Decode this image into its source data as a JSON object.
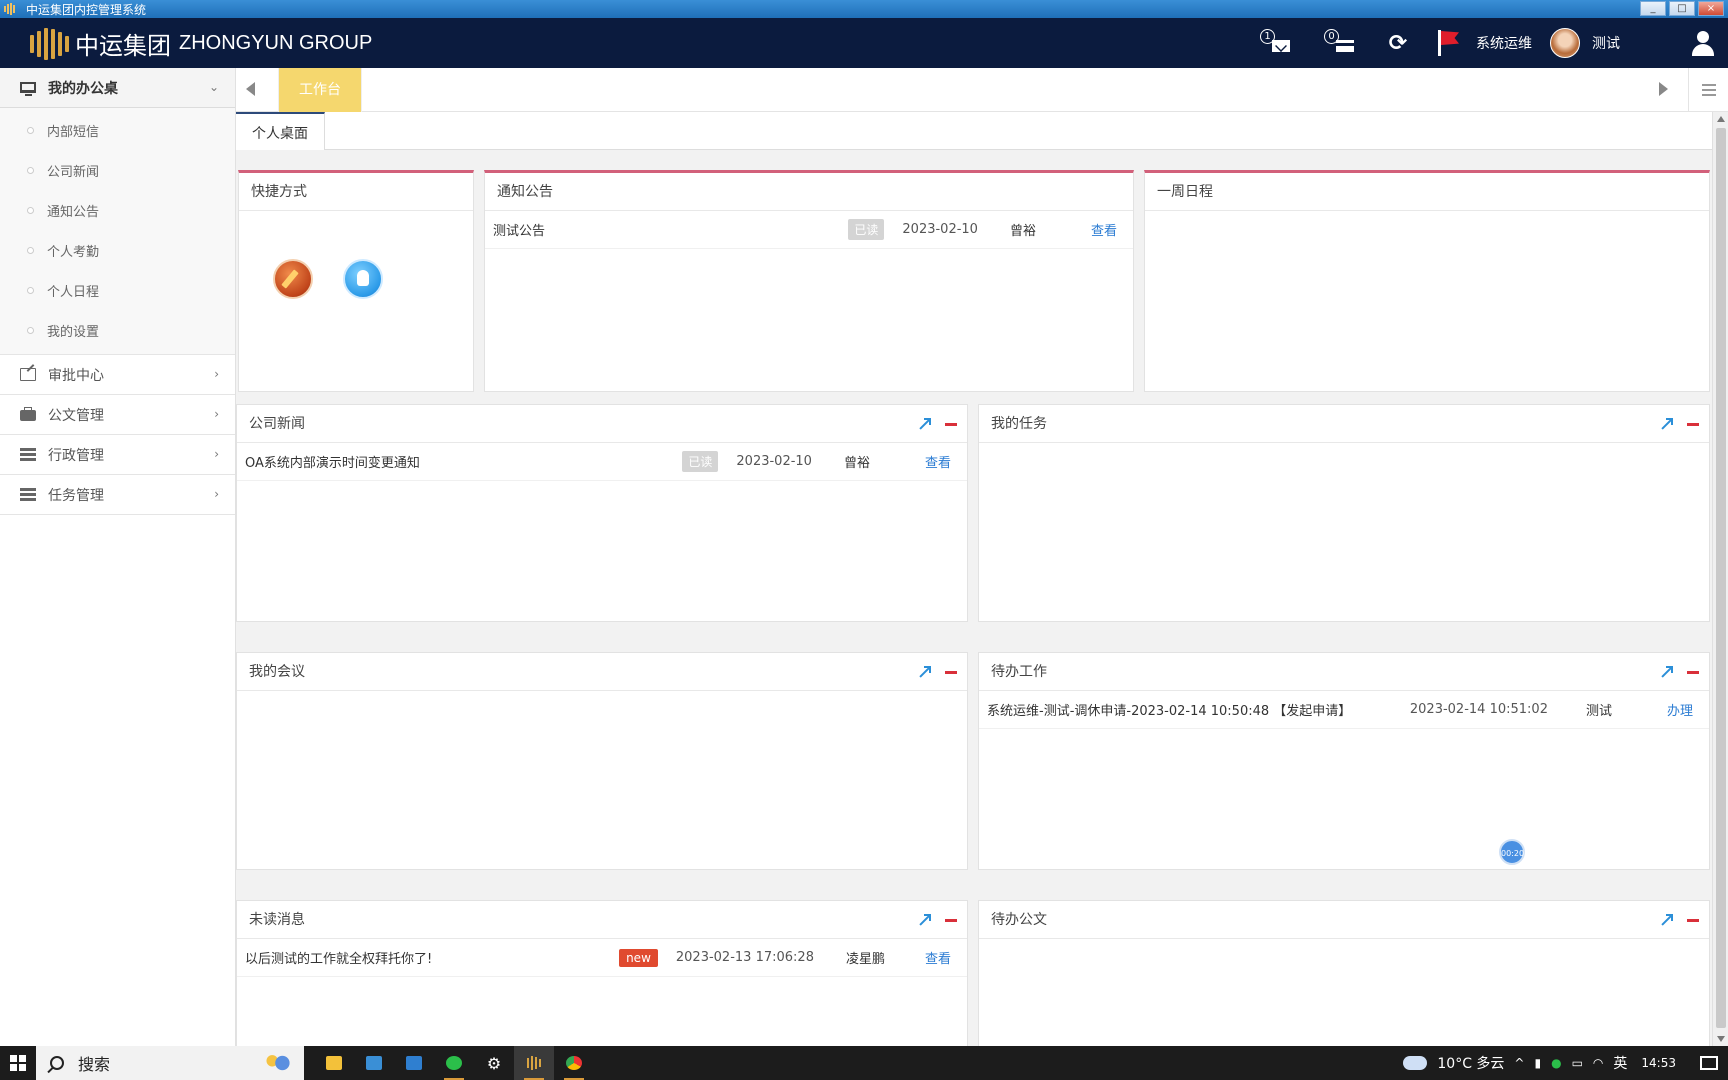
{
  "window": {
    "title": "中运集团内控管理系统",
    "buttons": [
      "_",
      "□",
      "×"
    ]
  },
  "header": {
    "brand_cn": "中运集团",
    "brand_en": "ZHONGYUN GROUP",
    "mail_count": "1",
    "notice_count": "0",
    "role_label": "系统运维",
    "user_name": "测试"
  },
  "sidebar": {
    "groups": [
      {
        "label": "我的办公桌",
        "icon": "monitor-icon",
        "expanded": true,
        "items": [
          "内部短信",
          "公司新闻",
          "通知公告",
          "个人考勤",
          "个人日程",
          "我的设置"
        ]
      },
      {
        "label": "审批中心",
        "icon": "edit-icon",
        "expanded": false
      },
      {
        "label": "公文管理",
        "icon": "briefcase-icon",
        "expanded": false
      },
      {
        "label": "行政管理",
        "icon": "server-icon",
        "expanded": false
      },
      {
        "label": "任务管理",
        "icon": "server-icon",
        "expanded": false
      }
    ]
  },
  "tabs": {
    "active": "工作台",
    "active_color": "#f5d76e"
  },
  "subtabs": {
    "active": "个人桌面"
  },
  "panels": {
    "shortcuts": {
      "title": "快捷方式"
    },
    "notices": {
      "title": "通知公告",
      "rows": [
        {
          "title": "测试公告",
          "status": "已读",
          "date": "2023-02-10",
          "user": "曾裕",
          "action": "查看"
        }
      ]
    },
    "week_schedule": {
      "title": "一周日程"
    },
    "company_news": {
      "title": "公司新闻",
      "rows": [
        {
          "title": "OA系统内部演示时间变更通知",
          "status": "已读",
          "date": "2023-02-10",
          "user": "曾裕",
          "action": "查看"
        }
      ]
    },
    "my_tasks": {
      "title": "我的任务"
    },
    "my_meetings": {
      "title": "我的会议"
    },
    "todo_work": {
      "title": "待办工作",
      "rows": [
        {
          "title": "系统运维-测试-调休申请-2023-02-14 10:50:48 【发起申请】",
          "date": "2023-02-14 10:51:02",
          "user": "测试",
          "action": "办理"
        }
      ],
      "timer": "00:20"
    },
    "unread_messages": {
      "title": "未读消息",
      "rows": [
        {
          "title": "以后测试的工作就全权拜托你了!",
          "status": "new",
          "date": "2023-02-13 17:06:28",
          "user": "凌星鹏",
          "action": "查看"
        }
      ]
    },
    "todo_docs": {
      "title": "待办公文"
    }
  },
  "taskbar": {
    "search_placeholder": "搜索",
    "weather": "10°C 多云",
    "ime": "英",
    "time": "14:53"
  },
  "colors": {
    "header_bg": "#0b1b3e",
    "panel_accent": "#d2607a",
    "link": "#2b7cd3",
    "new_badge": "#e04a2f"
  }
}
